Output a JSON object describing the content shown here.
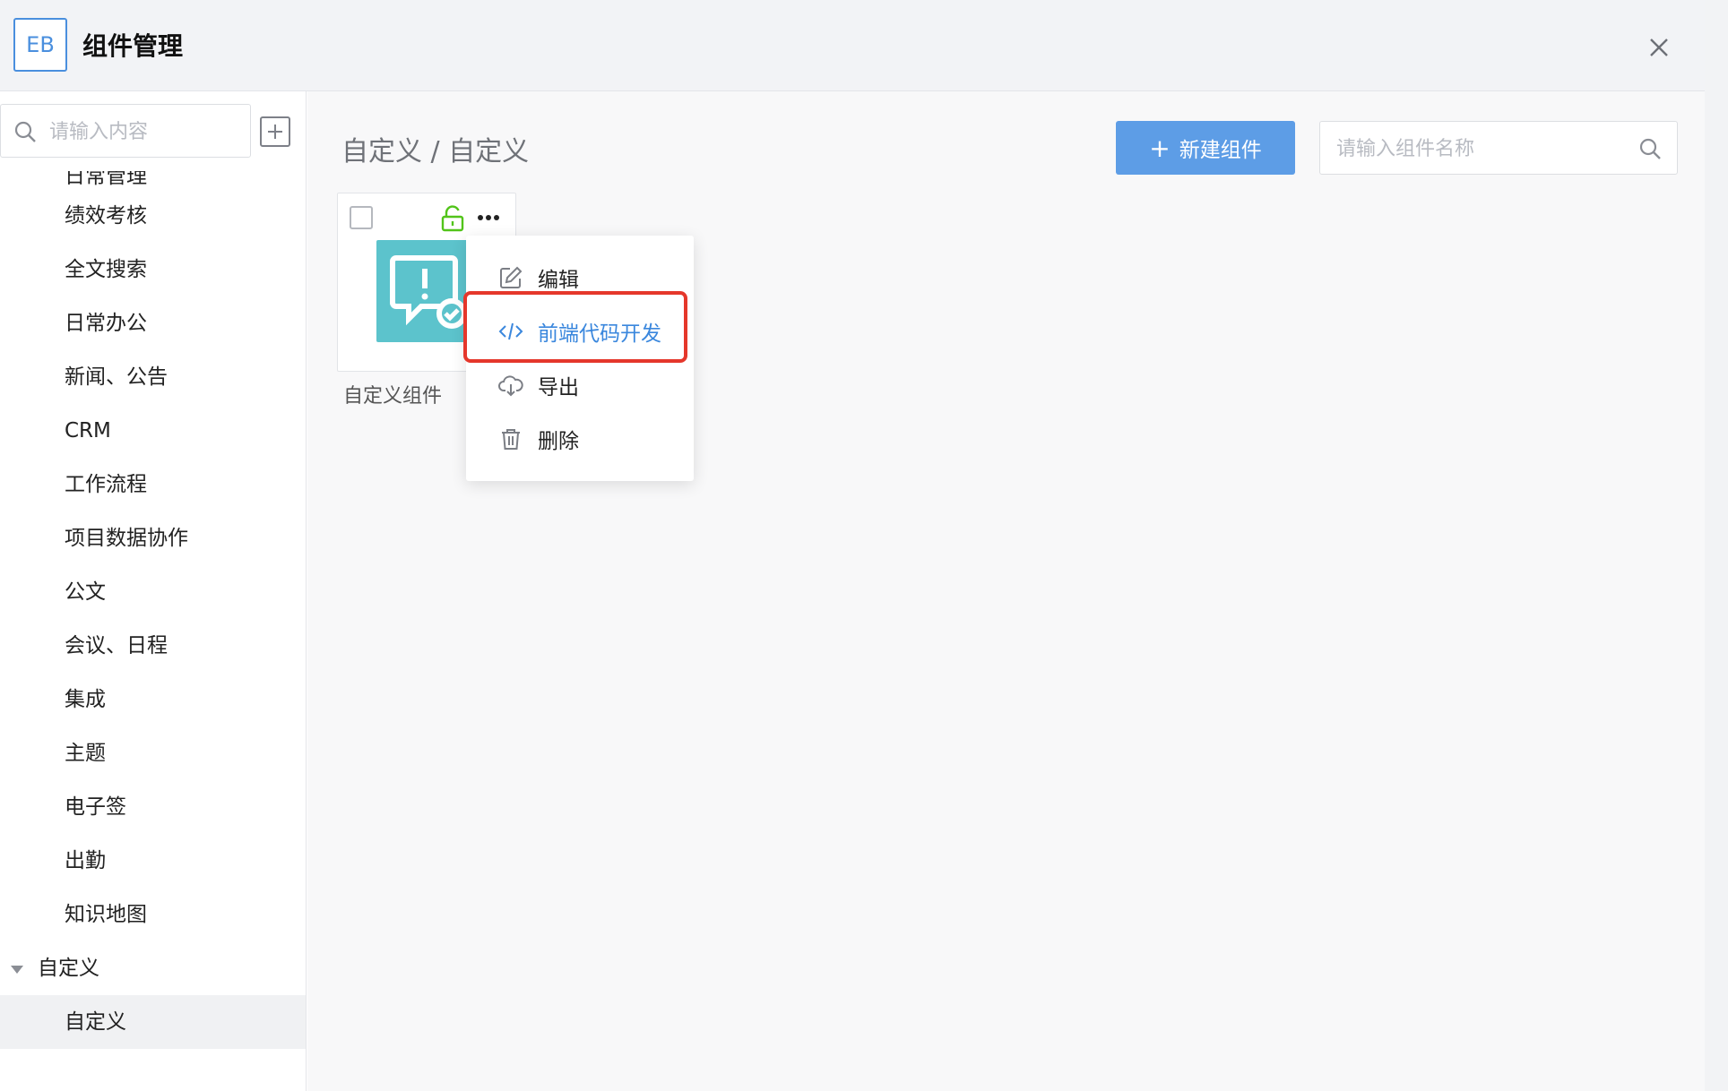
{
  "header": {
    "logo": "EB",
    "title": "组件管理",
    "close_icon": "close-icon"
  },
  "sidebar": {
    "search_placeholder": "请输入内容",
    "partial_item": "日常管理",
    "items": [
      "绩效考核",
      "全文搜索",
      "日常办公",
      "新闻、公告",
      "CRM",
      "工作流程",
      "项目数据协作",
      "公文",
      "会议、日程",
      "集成",
      "主题",
      "电子签",
      "出勤",
      "知识地图"
    ],
    "group": {
      "label": "自定义",
      "expanded": true
    },
    "active_item": "自定义"
  },
  "content": {
    "breadcrumb": "自定义 / 自定义",
    "new_button": "新建组件",
    "name_search_placeholder": "请输入组件名称",
    "card": {
      "label": "自定义组件",
      "lock_color": "#52c41a",
      "thumb_color": "#5cc3cc"
    },
    "menu": {
      "items": [
        {
          "label": "编辑",
          "icon": "edit-icon"
        },
        {
          "label": "前端代码开发",
          "icon": "code-icon",
          "highlight": true
        },
        {
          "label": "导出",
          "icon": "cloud-download-icon"
        },
        {
          "label": "删除",
          "icon": "trash-icon"
        }
      ]
    }
  },
  "colors": {
    "primary": "#5d9de6",
    "highlight_border": "#e5372b",
    "link": "#3a87dd"
  }
}
